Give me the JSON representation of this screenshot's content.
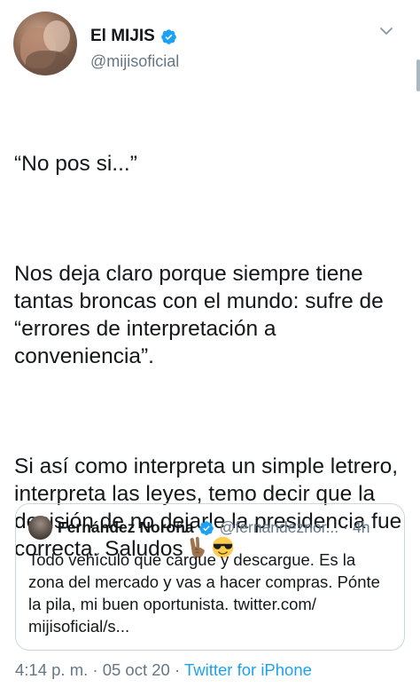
{
  "author": {
    "display_name": "El MIJIS",
    "handle": "@mijisoficial",
    "verified": true
  },
  "tweet": {
    "paragraphs": [
      "“No pos si...”",
      "Nos deja claro porque siempre tiene tantas broncas con el mundo: sufre de “errores de interpretación a conveniencia”.",
      "Si así como interpreta un simple letrero, interpreta las leyes, temo decir que la decisión de no dejarle la presidencia fue correcta. Saludos"
    ],
    "trailing_emojis": [
      "victory-hand",
      "sunglasses-face"
    ]
  },
  "quoted_tweet": {
    "display_name": "Fernández Noroña",
    "handle": "@fernandeznor...",
    "separator": "·",
    "time": "4h",
    "text": "Todo vehículo que cargue y descargue. Es la zona del mercado y vas a hacer compras. Pónte la pila, mi buen oportunista. twitter.com/ mijisoficial/s..."
  },
  "meta": {
    "time": "4:14 p. m.",
    "sep1": "·",
    "date": "05 oct 20",
    "sep2": "·",
    "source": "Twitter for iPhone"
  },
  "colors": {
    "verified_blue": "#1da1f2",
    "secondary_text": "#657786",
    "border": "#ccd6dd"
  }
}
